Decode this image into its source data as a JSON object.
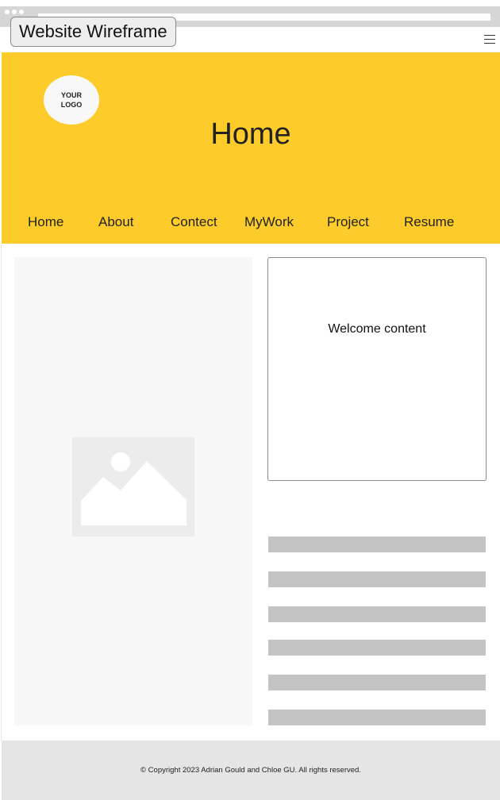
{
  "frame": {
    "title": "Website Wireframe"
  },
  "icons": {
    "menu": "hamburger-menu-icon",
    "image": "image-placeholder-icon"
  },
  "colors": {
    "header_bg": "#fdcc2a",
    "footer_bg": "#e5e5e5",
    "placeholder_bar": "#c4c4c4"
  },
  "header": {
    "logo_text": "YOUR\nLOGO",
    "title": "Home"
  },
  "nav": {
    "items": [
      {
        "label": "Home"
      },
      {
        "label": "About"
      },
      {
        "label": "Contect"
      },
      {
        "label": "MyWork"
      },
      {
        "label": "Project"
      },
      {
        "label": "Resume"
      }
    ]
  },
  "main": {
    "welcome_text": "Welcome content",
    "text_line_count": 6
  },
  "footer": {
    "copyright": "© Copyright 2023 Adrian Gould and Chloe GU. All rights reserved."
  }
}
